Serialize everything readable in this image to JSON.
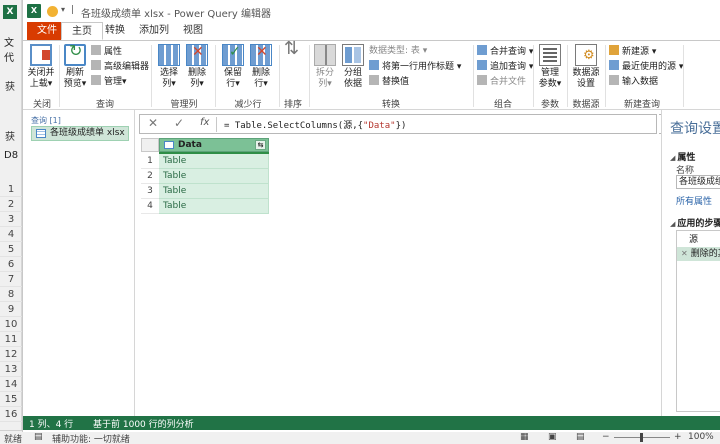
{
  "excel": {
    "logo": "X",
    "ribbon_tab": "文代",
    "name_box": "D8",
    "row_headers": [
      "1",
      "2",
      "3",
      "4",
      "5",
      "6",
      "7",
      "8",
      "9",
      "10",
      "11",
      "12",
      "13",
      "14",
      "15",
      "16"
    ],
    "left_label_1": "获",
    "left_label_2": "获",
    "status_ready": "就绪",
    "status_accessibility": "辅助功能: 一切就绪",
    "status_zoom": "100%"
  },
  "pq": {
    "title": "各班级成绩单 xlsx - Power Query 编辑器",
    "qat_sep": "|",
    "tabs": [
      {
        "label": "文件"
      },
      {
        "label": "主页"
      },
      {
        "label": "转换"
      },
      {
        "label": "添加列"
      },
      {
        "label": "视图"
      }
    ],
    "ribbon": {
      "close_group": {
        "btn_line1": "关闭并",
        "btn_line2": "上载▾",
        "label": "关闭"
      },
      "query_group": {
        "refresh_line1": "刷新",
        "refresh_line2": "预览▾",
        "props": "属性",
        "advanced": "高级编辑器",
        "manage": "管理▾",
        "label": "查询"
      },
      "manage_cols": {
        "select_line1": "选择",
        "select_line2": "列▾",
        "remove_line1": "删除",
        "remove_line2": "列▾",
        "label": "管理列"
      },
      "reduce_rows": {
        "keep_line1": "保留",
        "keep_line2": "行▾",
        "remove_line1": "删除",
        "remove_line2": "行▾",
        "label": "减少行"
      },
      "sort": {
        "label": "排序"
      },
      "transform": {
        "split_line1": "拆分",
        "split_line2": "列▾",
        "group_line1": "分组",
        "group_line2": "依据",
        "datatype": "数据类型: 表 ▾",
        "first_row": "将第一行用作标题 ▾",
        "replace": "替换值",
        "label": "转换"
      },
      "combine": {
        "merge": "合并查询 ▾",
        "append": "追加查询 ▾",
        "merge_files": "合并文件",
        "label": "组合"
      },
      "params": {
        "line1": "管理",
        "line2": "参数▾",
        "label": "参数"
      },
      "datasource": {
        "line1": "数据源",
        "line2": "设置",
        "label": "数据源"
      },
      "new_query": {
        "new_source": "新建源 ▾",
        "recent": "最近使用的源 ▾",
        "enter_data": "输入数据",
        "label": "新建查询"
      }
    },
    "queries": {
      "header": "查询 [1]",
      "items": [
        {
          "label": "各班级成绩单 xlsx"
        }
      ]
    },
    "formula_bar": {
      "cancel": "✕",
      "confirm": "✓",
      "fx": "fx",
      "prefix": "= Table.SelectColumns(源,{",
      "string": "\"Data\"",
      "suffix": "})",
      "chevron": "⌄"
    },
    "grid": {
      "column": "Data",
      "expand": "⇆",
      "rows": [
        {
          "num": "1",
          "value": "Table"
        },
        {
          "num": "2",
          "value": "Table"
        },
        {
          "num": "3",
          "value": "Table"
        },
        {
          "num": "4",
          "value": "Table"
        }
      ]
    },
    "settings": {
      "title": "查询设置",
      "props_section": "属性",
      "name_label": "名称",
      "name_value": "各班级成绩单",
      "all_props": "所有属性",
      "steps_section": "应用的步骤",
      "steps": [
        {
          "label": "源"
        },
        {
          "label": "删除的其他列"
        }
      ]
    },
    "status": {
      "cols_rows": "1 列、4 行",
      "profile": "基于前 1000 行的列分析"
    }
  }
}
